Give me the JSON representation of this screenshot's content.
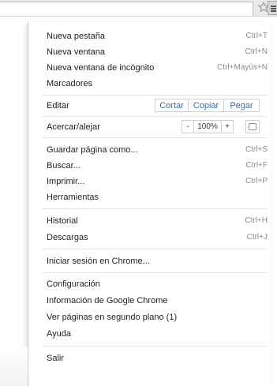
{
  "menu": {
    "group1": [
      {
        "label": "Nueva pestaña",
        "shortcut": "Ctrl+T"
      },
      {
        "label": "Nueva ventana",
        "shortcut": "Ctrl+N"
      },
      {
        "label": "Nueva ventana de incógnito",
        "shortcut": "Ctrl+Mayús+N"
      },
      {
        "label": "Marcadores",
        "shortcut": ""
      }
    ],
    "edit": {
      "label": "Editar",
      "cut": "Cortar",
      "copy": "Copiar",
      "paste": "Pegar"
    },
    "zoom": {
      "label": "Acercar/alejar",
      "minus": "-",
      "value": "100%",
      "plus": "+"
    },
    "group2": [
      {
        "label": "Guardar página como...",
        "shortcut": "Ctrl+S"
      },
      {
        "label": "Buscar...",
        "shortcut": "Ctrl+F"
      },
      {
        "label": "Imprimir...",
        "shortcut": "Ctrl+P"
      },
      {
        "label": "Herramientas",
        "shortcut": ""
      }
    ],
    "group3": [
      {
        "label": "Historial",
        "shortcut": "Ctrl+H"
      },
      {
        "label": "Descargas",
        "shortcut": "Ctrl+J"
      }
    ],
    "group4": [
      {
        "label": "Iniciar sesión en Chrome...",
        "shortcut": ""
      }
    ],
    "group5": [
      {
        "label": "Configuración",
        "shortcut": ""
      },
      {
        "label": "Información de Google Chrome",
        "shortcut": ""
      },
      {
        "label": "Ver páginas en segundo plano (1)",
        "shortcut": ""
      },
      {
        "label": "Ayuda",
        "shortcut": ""
      }
    ],
    "group6": [
      {
        "label": "Salir",
        "shortcut": ""
      }
    ]
  },
  "colors": {
    "link_blue": "#3a6ea8",
    "shortcut_gray": "#8a8a8a"
  }
}
